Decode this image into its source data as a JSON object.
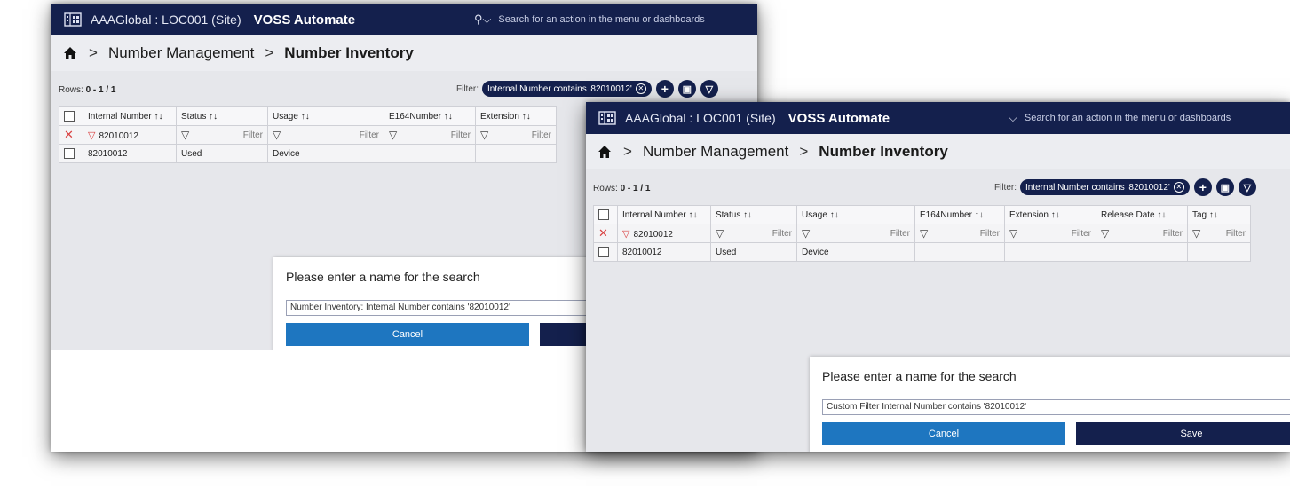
{
  "shots": [
    {
      "site": "AAAGlobal : LOC001 (Site)",
      "brand": "VOSS Automate",
      "search_placeholder": "Search for an action in the menu or dashboards",
      "breadcrumb": [
        "Number Management",
        "Number Inventory"
      ],
      "rows_label": "Rows:",
      "rows_value": "0 - 1 / 1",
      "filter_label": "Filter:",
      "filter_chip": "Internal Number contains '82010012'",
      "columns": [
        "Internal Number",
        "Status",
        "Usage",
        "E164Number",
        "Extension"
      ],
      "filter_values": [
        "82010012"
      ],
      "filter_placeholder": "Filter",
      "row": [
        "82010012",
        "Used",
        "Device",
        "",
        ""
      ],
      "modal_title": "Please enter a name for the search",
      "modal_input": "Number Inventory: Internal Number contains '82010012'",
      "cancel_label": "Cancel",
      "save_label": ""
    },
    {
      "site": "AAAGlobal : LOC001 (Site)",
      "brand": "VOSS Automate",
      "search_placeholder": "Search for an action in the menu or dashboards",
      "breadcrumb": [
        "Number Management",
        "Number Inventory"
      ],
      "rows_label": "Rows:",
      "rows_value": "0 - 1 / 1",
      "filter_label": "Filter:",
      "filter_chip": "Internal Number contains '82010012'",
      "columns": [
        "Internal Number",
        "Status",
        "Usage",
        "E164Number",
        "Extension",
        "Release Date",
        "Tag"
      ],
      "filter_values": [
        "82010012"
      ],
      "filter_placeholder": "Filter",
      "row": [
        "82010012",
        "Used",
        "Device",
        "",
        "",
        "",
        ""
      ],
      "modal_title": "Please enter a name for the search",
      "modal_input": "Custom Filter Internal Number contains '82010012'",
      "cancel_label": "Cancel",
      "save_label": "Save"
    }
  ],
  "sort_glyph": "↑↓",
  "active_sort_glyph": "↑↓",
  "colors": {
    "navy": "#14204d",
    "cancel_blue": "#1e76c0",
    "clear_red": "#d94040"
  },
  "icons": [
    "building-icon",
    "search-icon",
    "home-icon",
    "add-icon",
    "save-icon",
    "filter-icon",
    "clear-filter-icon"
  ]
}
